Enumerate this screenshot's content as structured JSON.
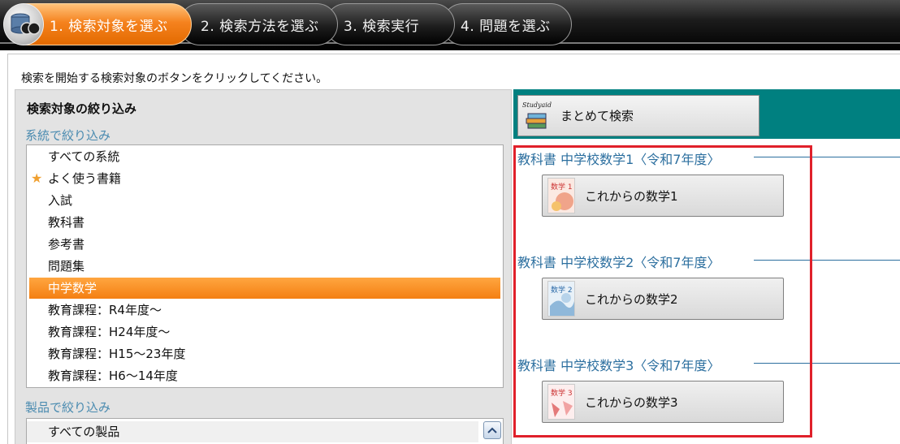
{
  "steps": [
    {
      "label": "1. 検索対象を選ぶ",
      "active": true
    },
    {
      "label": "2. 検索方法を選ぶ",
      "active": false
    },
    {
      "label": "3. 検索実行",
      "active": false
    },
    {
      "label": "4. 問題を選ぶ",
      "active": false
    }
  ],
  "instruction": "検索を開始する検索対象のボタンをクリックしてください。",
  "filter": {
    "heading": "検索対象の絞り込み",
    "system_label": "系統で絞り込み",
    "system_items": [
      "すべての系統",
      "よく使う書籍",
      "入試",
      "教科書",
      "参考書",
      "問題集",
      "中学数学",
      "教育課程：R4年度～",
      "教育課程：H24年度～",
      "教育課程：H15～23年度",
      "教育課程：H6～14年度"
    ],
    "selected_index": 6,
    "product_label": "製品で絞り込み",
    "product_items": [
      "すべての製品"
    ]
  },
  "results": {
    "bulk_button_label": "まとめて検索",
    "bulk_logo_text": "Studyaid D.B.",
    "groups": [
      {
        "heading": "教科書 中学校数学1〈令和7年度〉",
        "button_label": "これからの数学1",
        "cover_text": "数学 1"
      },
      {
        "heading": "教科書 中学校数学2〈令和7年度〉",
        "button_label": "これからの数学2",
        "cover_text": "数学 2"
      },
      {
        "heading": "教科書 中学校数学3〈令和7年度〉",
        "button_label": "これからの数学3",
        "cover_text": "数学 3"
      }
    ]
  },
  "colors": {
    "active_step": "#f5821e",
    "selected_item": "#f47f12",
    "teal_band": "#008080",
    "heading_blue": "#2c6f9f",
    "highlight": "#e0202a"
  }
}
